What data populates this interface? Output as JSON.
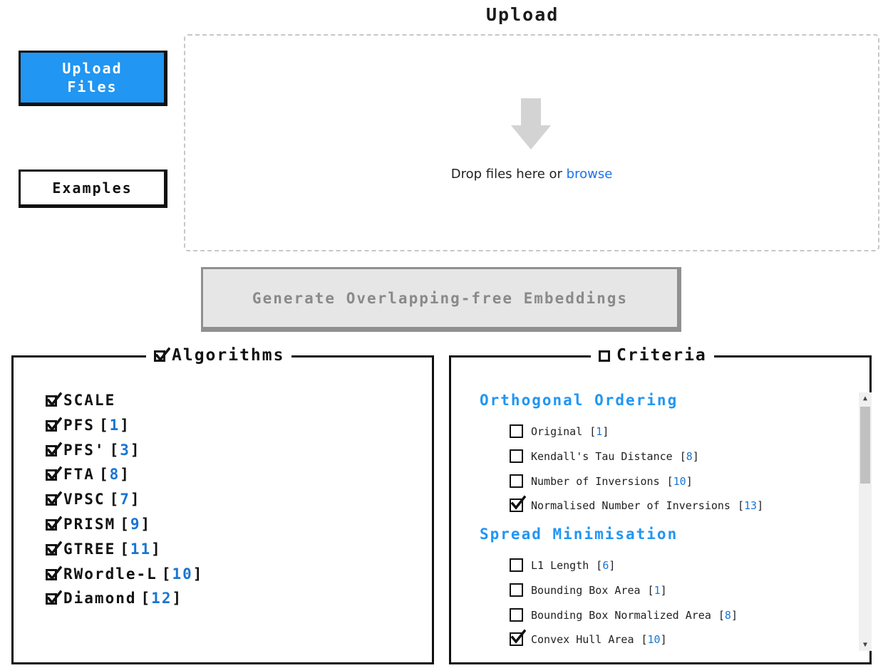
{
  "upload": {
    "title": "Upload",
    "upload_button": "Upload Files",
    "examples_button": "Examples",
    "drop_text": "Drop files here or",
    "browse_link": "browse"
  },
  "generate_button": "Generate Overlapping-free Embeddings",
  "algorithms": {
    "legend": "Algorithms",
    "checked": true,
    "items": [
      {
        "name": "SCALE",
        "ref": "",
        "checked": true
      },
      {
        "name": "PFS",
        "ref": "1",
        "checked": true
      },
      {
        "name": "PFS'",
        "ref": "3",
        "checked": true
      },
      {
        "name": "FTA",
        "ref": "8",
        "checked": true
      },
      {
        "name": "VPSC",
        "ref": "7",
        "checked": true
      },
      {
        "name": "PRISM",
        "ref": "9",
        "checked": true
      },
      {
        "name": "GTREE",
        "ref": "11",
        "checked": true
      },
      {
        "name": "RWordle-L",
        "ref": "10",
        "checked": true
      },
      {
        "name": "Diamond",
        "ref": "12",
        "checked": true
      }
    ]
  },
  "criteria": {
    "legend": "Criteria",
    "checked": false,
    "groups": [
      {
        "title": "Orthogonal Ordering",
        "items": [
          {
            "name": "Original",
            "ref": "1",
            "checked": false
          },
          {
            "name": "Kendall's Tau Distance",
            "ref": "8",
            "checked": false
          },
          {
            "name": "Number of Inversions",
            "ref": "10",
            "checked": false
          },
          {
            "name": "Normalised Number of Inversions",
            "ref": "13",
            "checked": true
          }
        ]
      },
      {
        "title": "Spread Minimisation",
        "items": [
          {
            "name": "L1 Length",
            "ref": "6",
            "checked": false
          },
          {
            "name": "Bounding Box Area",
            "ref": "1",
            "checked": false
          },
          {
            "name": "Bounding Box Normalized Area",
            "ref": "8",
            "checked": false
          },
          {
            "name": "Convex Hull Area",
            "ref": "10",
            "checked": true
          }
        ]
      }
    ]
  },
  "colors": {
    "accent": "#2196F3",
    "link": "#1976D2",
    "generate_disabled_bg": "#e6e6e6"
  },
  "icons": {
    "drop": "download-arrow-icon",
    "checkbox": "checkbox-icon"
  }
}
